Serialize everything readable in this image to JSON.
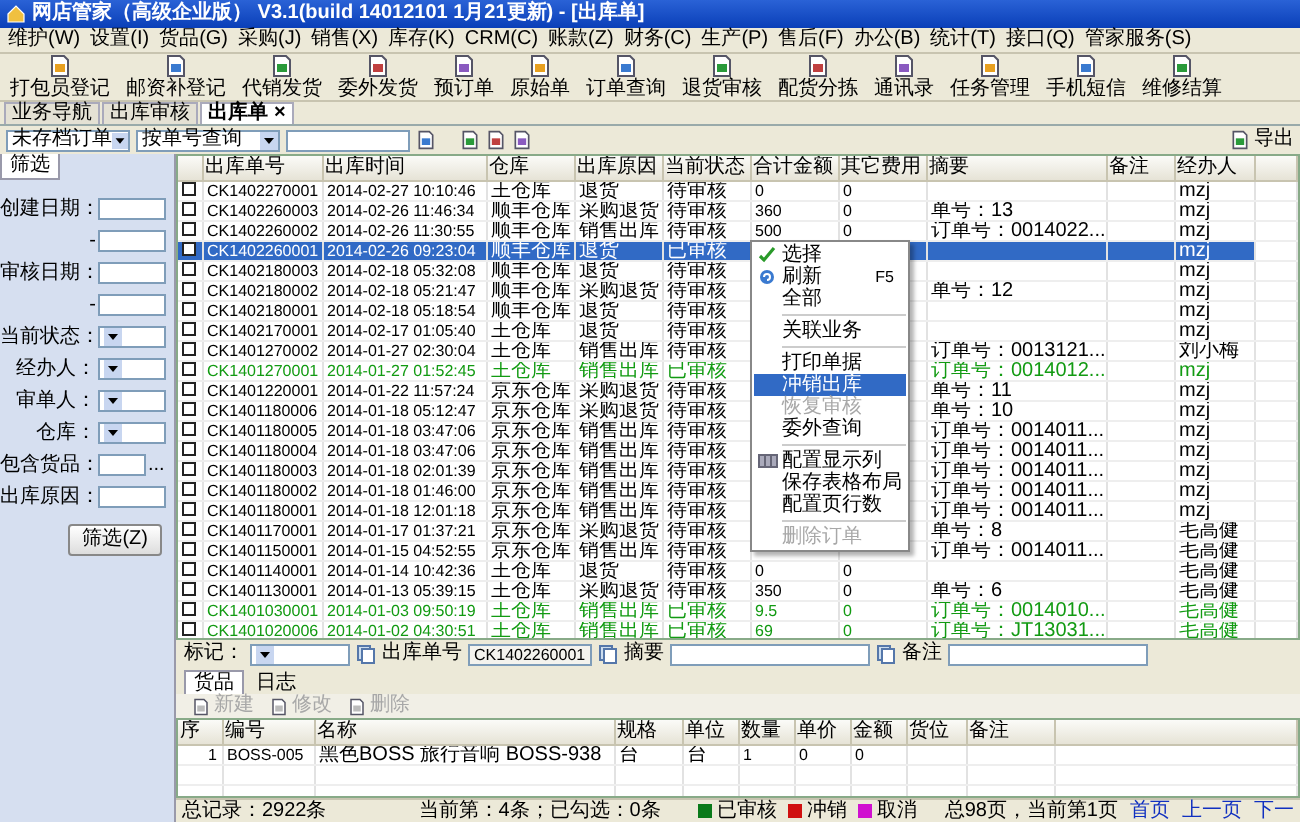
{
  "window": {
    "title": "网店管家（高级企业版） V3.1(build 14012101 1月21更新) - [出库单]"
  },
  "menu": [
    "维护(W)",
    "设置(I)",
    "货品(G)",
    "采购(J)",
    "销售(X)",
    "库存(K)",
    "CRM(C)",
    "账款(Z)",
    "财务(C)",
    "生产(P)",
    "售后(F)",
    "办公(B)",
    "统计(T)",
    "接口(Q)",
    "管家服务(S)"
  ],
  "toolbar": [
    "打包员登记",
    "邮资补登记",
    "代销发货",
    "委外发货",
    "预订单",
    "原始单",
    "订单查询",
    "退货审核",
    "配货分拣",
    "通讯录",
    "任务管理",
    "手机短信",
    "维修结算"
  ],
  "doc_tabs": [
    {
      "label": "业务导航",
      "selected": false
    },
    {
      "label": "出库审核",
      "selected": false
    },
    {
      "label": "出库单",
      "selected": true,
      "close": "×"
    }
  ],
  "filter_bar": {
    "scope": "未存档订单",
    "query_mode": "按单号查询",
    "export": "导出"
  },
  "filter_panel": {
    "tab": "筛选",
    "fields": [
      {
        "label": "创建日期：",
        "kind": "text"
      },
      {
        "label": "-",
        "kind": "text"
      },
      {
        "label": "审核日期：",
        "kind": "text"
      },
      {
        "label": "-",
        "kind": "text"
      },
      {
        "label": "当前状态：",
        "kind": "select"
      },
      {
        "label": "经办人：",
        "kind": "select"
      },
      {
        "label": "审单人：",
        "kind": "select"
      },
      {
        "label": "仓库：",
        "kind": "select"
      },
      {
        "label": "包含货品：",
        "kind": "browse",
        "more": "..."
      },
      {
        "label": "出库原因：",
        "kind": "text"
      }
    ],
    "button": "筛选(Z)"
  },
  "table": {
    "columns": [
      "出库单号",
      "出库时间",
      "仓库",
      "出库原因",
      "当前状态",
      "合计金额",
      "其它费用",
      "摘要",
      "备注",
      "经办人"
    ],
    "rows": [
      {
        "checked": false,
        "selected": false,
        "audited": false,
        "no": "CK1402270001",
        "time": "2014-02-27 10:10:46",
        "warehouse": "王仓库",
        "reason": "退货",
        "status": "待审核",
        "total": "0",
        "other": "0",
        "handler": "mzj"
      },
      {
        "checked": false,
        "selected": false,
        "audited": false,
        "no": "CK1402260003",
        "time": "2014-02-26 11:46:34",
        "warehouse": "顺丰仓库",
        "reason": "采购退货",
        "status": "待审核",
        "total": "360",
        "other": "0",
        "summary": "单号：13",
        "handler": "mzj"
      },
      {
        "checked": false,
        "selected": false,
        "audited": false,
        "no": "CK1402260002",
        "time": "2014-02-26 11:30:55",
        "warehouse": "顺丰仓库",
        "reason": "销售出库",
        "status": "待审核",
        "total": "500",
        "other": "0",
        "summary": "订单号：0014022...",
        "handler": "mzj"
      },
      {
        "checked": false,
        "selected": true,
        "audited": true,
        "no": "CK1402260001",
        "time": "2014-02-26 09:23:04",
        "warehouse": "顺丰仓库",
        "reason": "退货",
        "status": "已审核",
        "handler": "mzj"
      },
      {
        "checked": false,
        "selected": false,
        "audited": false,
        "no": "CK1402180003",
        "time": "2014-02-18 05:32:08",
        "warehouse": "顺丰仓库",
        "reason": "退货",
        "status": "待审核",
        "handler": "mzj"
      },
      {
        "checked": false,
        "selected": false,
        "audited": false,
        "no": "CK1402180002",
        "time": "2014-02-18 05:21:47",
        "warehouse": "顺丰仓库",
        "reason": "采购退货",
        "status": "待审核",
        "summary": "单号：12",
        "handler": "mzj"
      },
      {
        "checked": false,
        "selected": false,
        "audited": false,
        "no": "CK1402180001",
        "time": "2014-02-18 05:18:54",
        "warehouse": "顺丰仓库",
        "reason": "退货",
        "status": "待审核",
        "handler": "mzj"
      },
      {
        "checked": false,
        "selected": false,
        "audited": false,
        "no": "CK1402170001",
        "time": "2014-02-17 01:05:40",
        "warehouse": "王仓库",
        "reason": "退货",
        "status": "待审核",
        "handler": "mzj"
      },
      {
        "checked": false,
        "selected": false,
        "audited": false,
        "no": "CK1401270002",
        "time": "2014-01-27 02:30:04",
        "warehouse": "王仓库",
        "reason": "销售出库",
        "status": "待审核",
        "summary": "订单号：0013121...",
        "handler": "刘小梅"
      },
      {
        "checked": false,
        "selected": false,
        "audited": true,
        "no": "CK1401270001",
        "time": "2014-01-27 01:52:45",
        "warehouse": "王仓库",
        "reason": "销售出库",
        "status": "已审核",
        "summary": "订单号：0014012...",
        "handler": "mzj"
      },
      {
        "checked": false,
        "selected": false,
        "audited": false,
        "no": "CK1401220001",
        "time": "2014-01-22 11:57:24",
        "warehouse": "京东仓库",
        "reason": "采购退货",
        "status": "待审核",
        "summary": "单号：11",
        "handler": "mzj"
      },
      {
        "checked": false,
        "selected": false,
        "audited": false,
        "no": "CK1401180006",
        "time": "2014-01-18 05:12:47",
        "warehouse": "京东仓库",
        "reason": "采购退货",
        "status": "待审核",
        "summary": "单号：10",
        "handler": "mzj"
      },
      {
        "checked": false,
        "selected": false,
        "audited": false,
        "no": "CK1401180005",
        "time": "2014-01-18 03:47:06",
        "warehouse": "京东仓库",
        "reason": "销售出库",
        "status": "待审核",
        "summary": "订单号：0014011...",
        "handler": "mzj"
      },
      {
        "checked": false,
        "selected": false,
        "audited": false,
        "no": "CK1401180004",
        "time": "2014-01-18 03:47:06",
        "warehouse": "京东仓库",
        "reason": "销售出库",
        "status": "待审核",
        "summary": "订单号：0014011...",
        "handler": "mzj"
      },
      {
        "checked": false,
        "selected": false,
        "audited": false,
        "no": "CK1401180003",
        "time": "2014-01-18 02:01:39",
        "warehouse": "京东仓库",
        "reason": "销售出库",
        "status": "待审核",
        "summary": "订单号：0014011...",
        "handler": "mzj"
      },
      {
        "checked": false,
        "selected": false,
        "audited": false,
        "no": "CK1401180002",
        "time": "2014-01-18 01:46:00",
        "warehouse": "京东仓库",
        "reason": "销售出库",
        "status": "待审核",
        "summary": "订单号：0014011...",
        "handler": "mzj"
      },
      {
        "checked": false,
        "selected": false,
        "audited": false,
        "no": "CK1401180001",
        "time": "2014-01-18 12:01:18",
        "warehouse": "京东仓库",
        "reason": "销售出库",
        "status": "待审核",
        "summary": "订单号：0014011...",
        "handler": "mzj"
      },
      {
        "checked": false,
        "selected": false,
        "audited": false,
        "no": "CK1401170001",
        "time": "2014-01-17 01:37:21",
        "warehouse": "京东仓库",
        "reason": "采购退货",
        "status": "待审核",
        "summary": "单号：8",
        "handler": "毛高健"
      },
      {
        "checked": false,
        "selected": false,
        "audited": false,
        "no": "CK1401150001",
        "time": "2014-01-15 04:52:55",
        "warehouse": "京东仓库",
        "reason": "销售出库",
        "status": "待审核",
        "summary": "订单号：0014011...",
        "handler": "毛高健"
      },
      {
        "checked": false,
        "selected": false,
        "audited": false,
        "no": "CK1401140001",
        "time": "2014-01-14 10:42:36",
        "warehouse": "王仓库",
        "reason": "退货",
        "status": "待审核",
        "total": "0",
        "other": "0",
        "handler": "毛高健"
      },
      {
        "checked": false,
        "selected": false,
        "audited": false,
        "no": "CK1401130001",
        "time": "2014-01-13 05:39:15",
        "warehouse": "王仓库",
        "reason": "采购退货",
        "status": "待审核",
        "total": "350",
        "other": "0",
        "summary": "单号：6",
        "handler": "毛高健"
      },
      {
        "checked": false,
        "selected": false,
        "audited": true,
        "no": "CK1401030001",
        "time": "2014-01-03 09:50:19",
        "warehouse": "王仓库",
        "reason": "销售出库",
        "status": "已审核",
        "total": "9.5",
        "other": "0",
        "summary": "订单号：0014010...",
        "handler": "毛高健"
      },
      {
        "checked": false,
        "selected": false,
        "audited": true,
        "no": "CK1401020006",
        "time": "2014-01-02 04:30:51",
        "warehouse": "王仓库",
        "reason": "销售出库",
        "status": "已审核",
        "total": "69",
        "other": "0",
        "summary": "订单号：JT13031...",
        "handler": "毛高健"
      }
    ]
  },
  "context_menu": {
    "items": [
      {
        "kind": "item",
        "label": "选择",
        "highlighted": false,
        "disabled": false
      },
      {
        "kind": "item",
        "label": "刷新",
        "shortcut": "F5",
        "highlighted": false,
        "disabled": false
      },
      {
        "kind": "item",
        "label": "全部",
        "highlighted": false,
        "disabled": false
      },
      {
        "kind": "separator"
      },
      {
        "kind": "item",
        "label": "关联业务",
        "highlighted": false,
        "disabled": false
      },
      {
        "kind": "separator"
      },
      {
        "kind": "item",
        "label": "打印单据",
        "highlighted": false,
        "disabled": false
      },
      {
        "kind": "item",
        "label": "冲销出库",
        "highlighted": true,
        "disabled": false
      },
      {
        "kind": "item",
        "label": "恢复审核",
        "highlighted": false,
        "disabled": true
      },
      {
        "kind": "item",
        "label": "委外查询",
        "highlighted": false,
        "disabled": false
      },
      {
        "kind": "separator"
      },
      {
        "kind": "item",
        "label": "配置显示列",
        "highlighted": false,
        "disabled": false
      },
      {
        "kind": "item",
        "label": "保存表格布局",
        "highlighted": false,
        "disabled": false
      },
      {
        "kind": "item",
        "label": "配置页行数",
        "highlighted": false,
        "disabled": false
      },
      {
        "kind": "separator"
      },
      {
        "kind": "item",
        "label": "删除订单",
        "highlighted": false,
        "disabled": true
      }
    ]
  },
  "detail": {
    "mark_label": "标记：",
    "order_label": "出库单号",
    "order_value": "CK1402260001",
    "summary_label": "摘要",
    "remark_label": "备注",
    "tabs": [
      {
        "label": "货品",
        "selected": true
      },
      {
        "label": "日志",
        "selected": false
      }
    ],
    "actions": [
      {
        "label": "新建",
        "disabled": true
      },
      {
        "label": "修改",
        "disabled": true
      },
      {
        "label": "删除",
        "disabled": true
      }
    ],
    "columns": [
      "序",
      "编号",
      "名称",
      "规格",
      "单位",
      "数量",
      "单价",
      "金额",
      "货位",
      "备注"
    ],
    "rows": [
      [
        "1",
        "BOSS-005",
        "黑色BOSS 旅行音响 BOSS-938",
        "台",
        "台",
        "1",
        "0",
        "0",
        "",
        ""
      ]
    ]
  },
  "status_bar": {
    "total": "总记录：2922条",
    "position": "当前第：4条；已勾选：0条",
    "legend": [
      {
        "label": "已审核",
        "color": "#0a7a1a"
      },
      {
        "label": "冲销",
        "color": "#d01010"
      },
      {
        "label": "取消",
        "color": "#d010d0"
      }
    ],
    "pages": "总98页，当前第1页",
    "nav": [
      "首页",
      "上一页",
      "下一"
    ]
  }
}
